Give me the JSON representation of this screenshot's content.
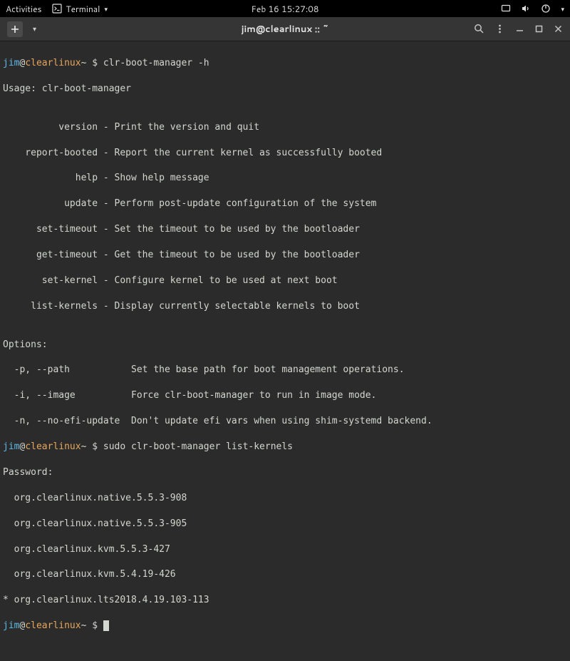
{
  "top_bar": {
    "activities": "Activities",
    "app_name": "Terminal",
    "datetime": "Feb 16  15:27:08"
  },
  "title_bar": {
    "title": "jim@clearlinux :: ~"
  },
  "prompt": {
    "user": "jim",
    "at": "@",
    "host": "clearlinux",
    "path": "~",
    "symbol": " $ "
  },
  "session": {
    "cmd1": "clr-boot-manager -h",
    "out1_usage": "Usage: clr-boot-manager",
    "out1_blank": "",
    "out1_version": "          version - Print the version and quit",
    "out1_report": "    report-booted - Report the current kernel as successfully booted",
    "out1_help": "             help - Show help message",
    "out1_update": "           update - Perform post-update configuration of the system",
    "out1_settimeout": "      set-timeout - Set the timeout to be used by the bootloader",
    "out1_gettimeout": "      get-timeout - Get the timeout to be used by the bootloader",
    "out1_setkernel": "       set-kernel - Configure kernel to be used at next boot",
    "out1_listkernels": "     list-kernels - Display currently selectable kernels to boot",
    "out1_optshdr": "Options:",
    "out1_optpath": "  -p, --path           Set the base path for boot management operations.",
    "out1_optimage": "  -i, --image          Force clr-boot-manager to run in image mode.",
    "out1_optnoefi": "  -n, --no-efi-update  Don't update efi vars when using shim-systemd backend.",
    "cmd2": "sudo clr-boot-manager list-kernels",
    "out2_pw": "Password:",
    "out2_k1": "  org.clearlinux.native.5.5.3-908",
    "out2_k2": "  org.clearlinux.native.5.5.3-905",
    "out2_k3": "  org.clearlinux.kvm.5.5.3-427",
    "out2_k4": "  org.clearlinux.kvm.5.4.19-426",
    "out2_k5": "* org.clearlinux.lts2018.4.19.103-113"
  }
}
